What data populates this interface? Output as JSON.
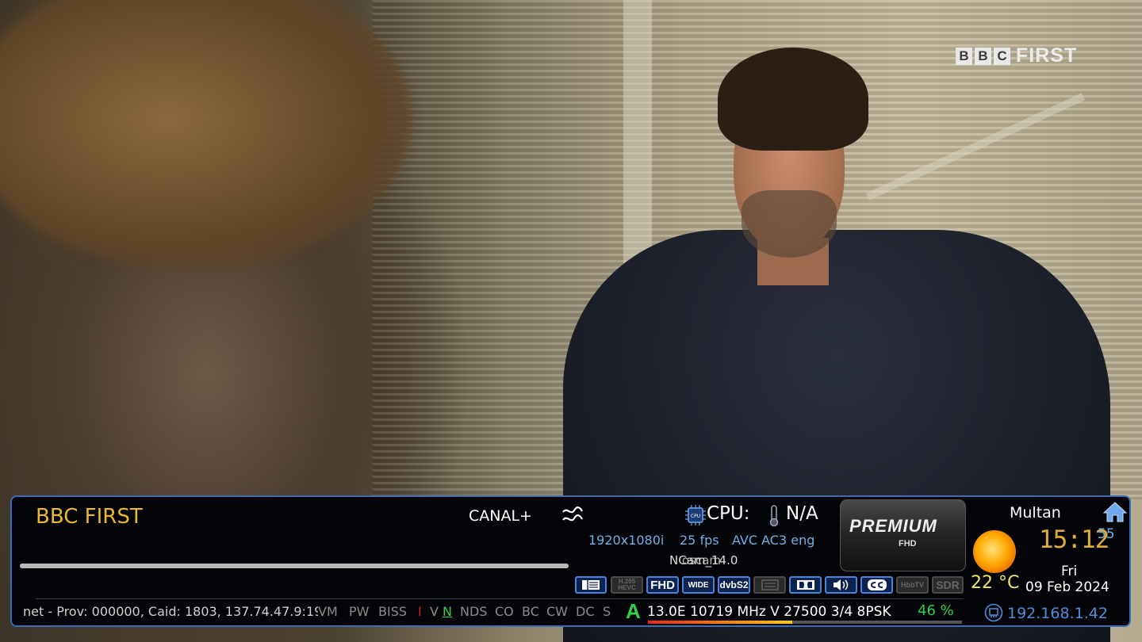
{
  "logo": {
    "bbc_letters": [
      "B",
      "B",
      "C"
    ],
    "word": "FIRST"
  },
  "infobar": {
    "channel_name": "BBC FIRST",
    "provider": "CANAL+",
    "cpu_label": "CPU:",
    "temp_value": "N/A",
    "resolution": "1920x1080i",
    "fps": "25 fps",
    "codec": "AVC AC3 eng",
    "cam_overlap_a": "NCam_14.0",
    "cam_overlap_b": "oscam",
    "progress": 1.0,
    "premium_title": "PREMIUM",
    "premium_sub": "FHD",
    "city": "Multan",
    "clock": "15:12",
    "seconds": "55",
    "weekday": "Fri",
    "date": "09 Feb 2024",
    "temperature": "22 °C",
    "badges": [
      {
        "label": "",
        "icon": "decoder-icon",
        "active": true
      },
      {
        "label": "H.265 HEVC",
        "active": false
      },
      {
        "label": "FHD",
        "active": true
      },
      {
        "label": "WIDE",
        "active": true
      },
      {
        "label": "dvbS2",
        "active": true
      },
      {
        "label": "",
        "icon": "teletext-icon",
        "active": false
      },
      {
        "label": "",
        "icon": "dolby-icon",
        "active": true
      },
      {
        "label": "",
        "icon": "speaker-icon",
        "active": true
      },
      {
        "label": "",
        "icon": "cc-icon",
        "active": true
      },
      {
        "label": "HbbTV",
        "active": false
      },
      {
        "label": "SDR",
        "active": false
      }
    ],
    "ecm_info": "net - Prov: 000000, Caid: 1803, 137.74.47.9:19000",
    "caids": [
      {
        "label": "VM",
        "color": "#8c8c8c"
      },
      {
        "label": "PW",
        "color": "#8c8c8c"
      },
      {
        "label": "BISS",
        "color": "#8c8c8c"
      },
      {
        "label": "I",
        "color": "#e02020"
      },
      {
        "label": "V",
        "color": "#8c8c8c"
      },
      {
        "label": "N",
        "color": "#2fd04b"
      },
      {
        "label": "NDS",
        "color": "#8c8c8c"
      },
      {
        "label": "CO",
        "color": "#8c8c8c"
      },
      {
        "label": "BC",
        "color": "#8c8c8c"
      },
      {
        "label": "CW",
        "color": "#8c8c8c"
      },
      {
        "label": "DC",
        "color": "#8c8c8c"
      },
      {
        "label": "S",
        "color": "#8c8c8c"
      }
    ],
    "signal_letter": "A",
    "tuner_info": "13.0E 10719 MHz V 27500 3/4 8PSK",
    "snr": "46 %",
    "snr_value": 0.46,
    "ip": "192.168.1.42"
  }
}
